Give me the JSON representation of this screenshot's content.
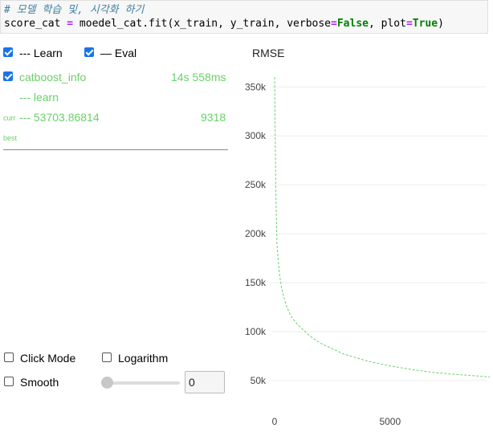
{
  "code": {
    "comment": "# 모델 학습 및, 시각화 하기",
    "line_prefix": "score_cat ",
    "assign_op": "=",
    "call": " moedel_cat.fit(x_train, y_train, verbose",
    "eq1": "=",
    "false_kw": "False",
    "mid": ", plot",
    "eq2": "=",
    "true_kw": "True",
    "close": ")"
  },
  "legend": {
    "learn_label": "--- Learn",
    "learn_checked": true,
    "eval_label": "— Eval",
    "eval_checked": true
  },
  "run": {
    "name": "catboost_info",
    "checked": true,
    "elapsed": "14s 558ms",
    "series_label": "--- learn",
    "curr_label": "curr",
    "curr_value": "--- 53703.86814",
    "curr_iter": "9318",
    "best_label": "best"
  },
  "controls": {
    "click_mode_label": "Click Mode",
    "click_mode_checked": false,
    "logarithm_label": "Logarithm",
    "logarithm_checked": false,
    "smooth_label": "Smooth",
    "smooth_checked": false,
    "smooth_value": "0"
  },
  "colors": {
    "accent": "#1a73e8",
    "series": "#6ad06a"
  },
  "chart_data": {
    "type": "line",
    "title": "RMSE",
    "xlabel": "",
    "ylabel": "",
    "xlim": [
      0,
      9318
    ],
    "ylim": [
      45000,
      365000
    ],
    "x_ticks": [
      0,
      5000
    ],
    "y_ticks": [
      50000,
      100000,
      150000,
      200000,
      250000,
      300000,
      350000
    ],
    "y_tick_labels": [
      "50k",
      "100k",
      "150k",
      "200k",
      "250k",
      "300k",
      "350k"
    ],
    "grid": true,
    "series": [
      {
        "name": "learn",
        "style": "dashed",
        "x": [
          0,
          50,
          100,
          200,
          300,
          400,
          500,
          700,
          1000,
          1500,
          2000,
          3000,
          4000,
          5000,
          6000,
          7000,
          8000,
          9318
        ],
        "y": [
          360000,
          250000,
          190000,
          160000,
          145000,
          135000,
          127000,
          116000,
          107000,
          96000,
          88000,
          77000,
          70000,
          65000,
          61000,
          58000,
          56000,
          53704
        ]
      }
    ]
  }
}
